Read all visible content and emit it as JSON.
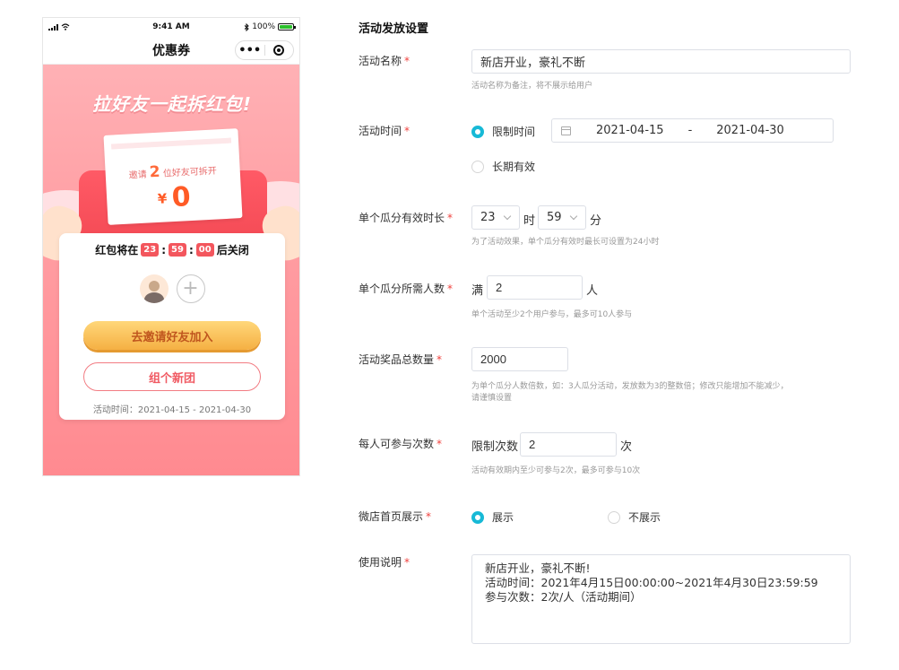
{
  "phone": {
    "status_time": "9:41 AM",
    "battery_text": "100%",
    "battery_level": 1.0,
    "nav_title": "优惠券",
    "capsule_more": "•••",
    "headline": "拉好友一起拆红包!",
    "coupon": {
      "invite_prefix": "邀请",
      "invite_count": "2",
      "invite_suffix": "位好友可拆开",
      "currency": "¥",
      "amount": "0"
    },
    "card": {
      "countdown_prefix": "红包将在",
      "hours": "23",
      "minutes": "59",
      "seconds": "00",
      "sep": ":",
      "countdown_suffix": "后关闭",
      "add_symbol": "+",
      "invite_button": "去邀请好友加入",
      "new_group_button": "组个新团",
      "period": "活动时间：2021-04-15 - 2021-04-30"
    }
  },
  "form": {
    "section_title": "活动发放设置",
    "required_mark": "*",
    "name": {
      "label": "活动名称",
      "value": "新店开业，豪礼不断",
      "hint": "活动名称为备注，将不展示给用户"
    },
    "time": {
      "label": "活动时间",
      "option_limited": "限制时间",
      "start": "2021-04-15",
      "dash": "-",
      "end": "2021-04-30",
      "option_long": "长期有效"
    },
    "duration": {
      "label": "单个瓜分有效时长",
      "hours": "23",
      "hour_unit": "时",
      "minutes": "59",
      "minute_unit": "分",
      "hint": "为了活动效果，单个瓜分有效时最长可设置为24小时"
    },
    "people": {
      "label": "单个瓜分所需人数",
      "prefix": "满",
      "value": "2",
      "unit": "人",
      "hint": "单个活动至少2个用户参与，最多可10人参与"
    },
    "total": {
      "label": "活动奖品总数量",
      "value": "2000",
      "hint_line1": "为单个瓜分人数倍数，如：3人瓜分活动，发放数为3的整数倍；修改只能增加不能减少，",
      "hint_line2": "请谨慎设置"
    },
    "times": {
      "label": "每人可参与次数",
      "prefix": "限制次数",
      "value": "2",
      "unit": "次",
      "hint": "活动有效期内至少可参与2次，最多可参与10次"
    },
    "display": {
      "label": "微店首页展示",
      "option_show": "展示",
      "option_hide": "不展示"
    },
    "usage": {
      "label": "使用说明",
      "line1": "新店开业，豪礼不断!",
      "line2": "活动时间：2021年4月15日00:00:00~2021年4月30日23:59:59",
      "line3": "参与次数：2次/人（活动期间）"
    }
  }
}
